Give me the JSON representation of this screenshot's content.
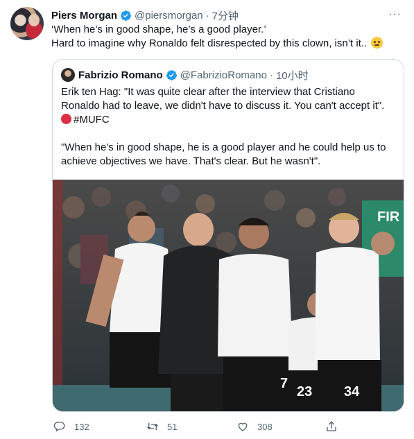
{
  "author": {
    "name": "Piers Morgan",
    "handle": "@piersmorgan",
    "separator": "·",
    "time": "7分钟"
  },
  "tweet_text": {
    "line1": "‘When he’s in good shape, he’s a good player.’",
    "line2": "Hard to imagine why Ronaldo felt disrespected by this clown, isn’t it.."
  },
  "quoted": {
    "name": "Fabrizio Romano",
    "handle": "@FabrizioRomano",
    "separator": "·",
    "time": "10小时",
    "paragraph1": "Erik ten Hag: \"It was quite clear after the interview that Cristiano Ronaldo had to leave, we didn't have to discuss it. You can't accept it\".",
    "hashtag": "#MUFC",
    "paragraph2": "\"When he's in good shape, he is a good player and he could help us to achieve objectives we have. That's clear. But he wasn't\".",
    "photo": {
      "shirt_numbers": [
        "7",
        "23",
        "34"
      ],
      "sponsor_text": "FIR"
    }
  },
  "actions": {
    "replies": "132",
    "retweets": "51",
    "likes": "308"
  },
  "colors": {
    "accent": "#1d9bf0",
    "text": "#0f1419",
    "muted": "#536471",
    "border": "#cfd9de"
  },
  "icons": [
    "verified-badge-icon",
    "more-icon",
    "reply-icon",
    "retweet-icon",
    "like-icon",
    "share-icon",
    "red-circle-emoji",
    "rolling-eyes-emoji"
  ]
}
